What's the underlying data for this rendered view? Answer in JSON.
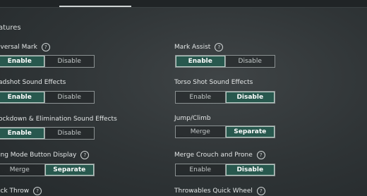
{
  "section_title": "atures",
  "settings": [
    {
      "key": "universal_mark",
      "label": "iversal Mark",
      "help": true,
      "options": [
        "Enable",
        "Disable"
      ],
      "selected": 0
    },
    {
      "key": "mark_assist",
      "label": "Mark Assist",
      "help": true,
      "options": [
        "Enable",
        "Disable"
      ],
      "selected": 0
    },
    {
      "key": "headshot_sfx",
      "label": "adshot Sound Effects",
      "help": false,
      "options": [
        "Enable",
        "Disable"
      ],
      "selected": 0
    },
    {
      "key": "torso_sfx",
      "label": "Torso Shot Sound Effects",
      "help": false,
      "options": [
        "Enable",
        "Disable"
      ],
      "selected": 1
    },
    {
      "key": "knockdown_sfx",
      "label": "ockdown & Elimination Sound Effects",
      "help": false,
      "options": [
        "Enable",
        "Disable"
      ],
      "selected": 0
    },
    {
      "key": "jump_climb",
      "label": "Jump/Climb",
      "help": false,
      "options": [
        "Merge",
        "Separate"
      ],
      "selected": 1
    },
    {
      "key": "moving_mode_display",
      "label": "ing Mode Button Display",
      "help": true,
      "options": [
        "Merge",
        "Separate"
      ],
      "selected": 1
    },
    {
      "key": "merge_crouch_prone",
      "label": "Merge Crouch and Prone",
      "help": true,
      "options": [
        "Enable",
        "Disable"
      ],
      "selected": 1
    },
    {
      "key": "quick_throw",
      "label": "ick Throw",
      "help": true
    },
    {
      "key": "throwables_quick_wheel",
      "label": "Throwables Quick Wheel",
      "help": true
    }
  ],
  "help_glyph": "?",
  "colors": {
    "selected_bg": "#28584e",
    "border": "#8b9192"
  }
}
